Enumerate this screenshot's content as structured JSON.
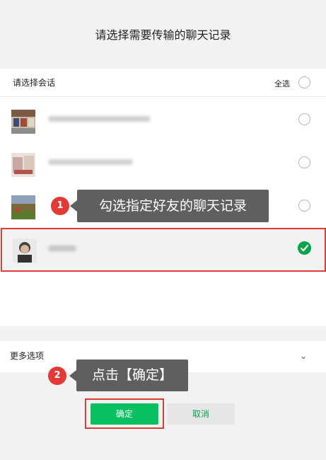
{
  "title": "请选择需要传输的聊天记录",
  "list_header": {
    "label": "请选择会话",
    "select_all": "全选"
  },
  "rows": [
    {
      "selected": false
    },
    {
      "selected": false
    },
    {
      "selected": false
    },
    {
      "selected": true
    }
  ],
  "more_options": {
    "label": "更多选项",
    "chevron": "⌄"
  },
  "annotations": {
    "step1": {
      "badge": "1",
      "text": "勾选指定好友的聊天记录"
    },
    "step2": {
      "badge": "2",
      "text": "点击【确定】"
    }
  },
  "buttons": {
    "ok": "确定",
    "cancel": "取消"
  },
  "colors": {
    "accent": "#07c160",
    "highlight": "#e53935",
    "tooltip": "#5f5f5f"
  }
}
